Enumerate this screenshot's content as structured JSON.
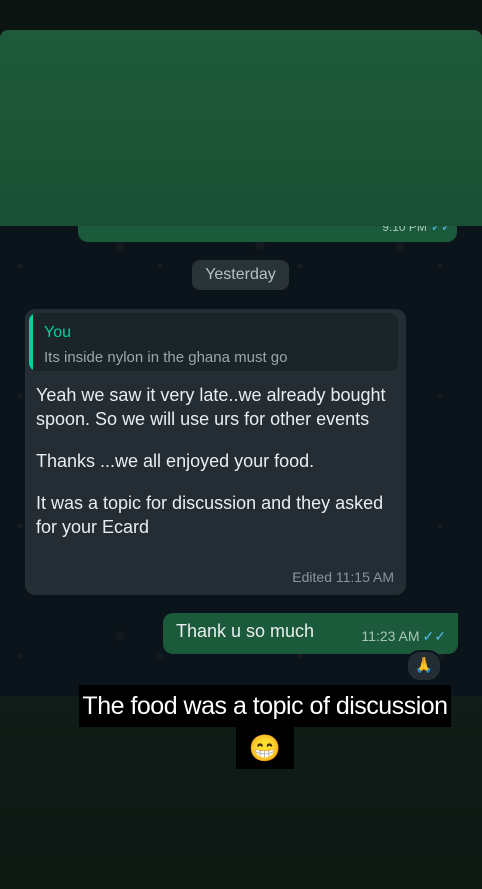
{
  "previous_message": {
    "time": "9:10 PM",
    "status_icon": "double-check-icon"
  },
  "date_separator": "Yesterday",
  "incoming_message": {
    "reply_author": "You",
    "reply_text": "Its inside nylon in the ghana must go",
    "paragraphs": [
      "Yeah we saw it very late..we already bought spoon. So we will use urs for other events",
      "Thanks ...we all enjoyed your food.",
      "It was a topic for discussion and they asked for your Ecard"
    ],
    "meta": "Edited 11:15 AM"
  },
  "outgoing_message": {
    "text": "Thank u so much",
    "time": "11:23 AM",
    "status_icon": "double-check-icon",
    "reaction": "🙏"
  },
  "story_caption": {
    "text": "The food was a topic of discussion",
    "emoji": "😁"
  },
  "colors": {
    "accent_green": "#06cf9c",
    "outgoing_bubble": "#1c5a3c",
    "incoming_bubble": "#232d33",
    "read_tick": "#53bdeb"
  }
}
